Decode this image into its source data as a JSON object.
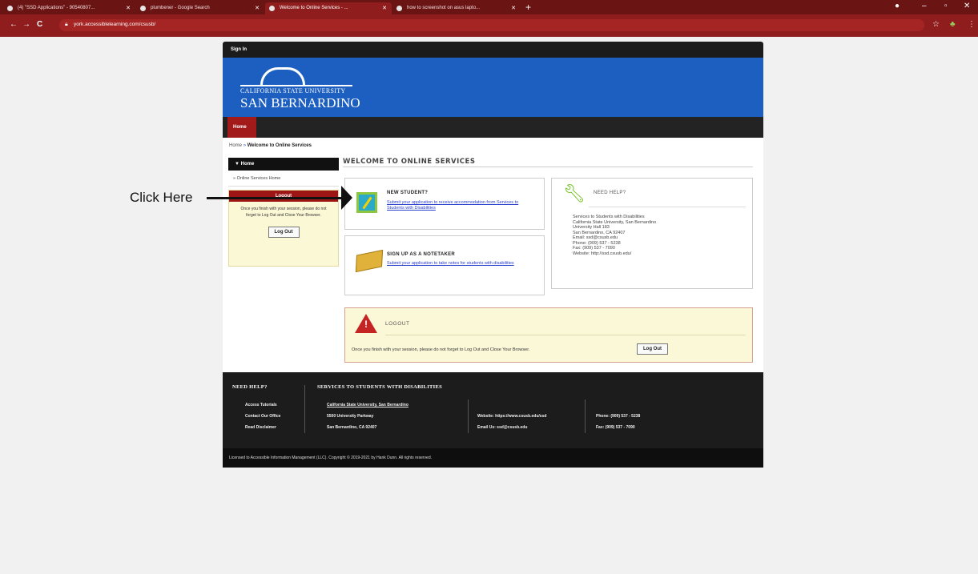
{
  "browser": {
    "tabs": [
      {
        "label": "(4) \"SSD Applications\" - 90540807..."
      },
      {
        "label": "plumbener - Google Search"
      },
      {
        "label": "Welcome to Online Services - ...",
        "active": true
      },
      {
        "label": "how to screenshot on asus lapto..."
      }
    ],
    "new_tab": "+",
    "url": "york.accessiblelearning.com/csusb/",
    "back": "←",
    "forward": "→",
    "reload": "C",
    "min": "–",
    "max": "▫",
    "close": "✕",
    "star": "☆",
    "profile": "●"
  },
  "site": {
    "signin": "Sign In",
    "logo_line1": "CALIFORNIA STATE UNIVERSITY",
    "logo_line2": "SAN BERNARDINO",
    "nav_home": "Home",
    "breadcrumb_home": "Home",
    "breadcrumb_sep": "»",
    "breadcrumb_current": "Welcome to Online Services",
    "leftnav_header": "▼ Home",
    "leftnav_item": "» Online Services Home",
    "logout_header": "Logout",
    "logout_text": "Once you finish with your session, please do not forget to Log Out and Close Your Browser.",
    "logout_button": "Log Out",
    "welcome_title": "WELCOME TO ONLINE SERVICES",
    "new_student_title": "NEW STUDENT?",
    "new_student_link": "Submit your application to receive accommodation from Services to Students with Disabilities",
    "notetaker_title": "SIGN UP AS A NOTETAKER",
    "notetaker_link": "Submit your application to take notes for students with disabilities",
    "help_title": "NEED HELP?",
    "help_contact": [
      "Services to Students with Disabilities",
      "California State University, San Bernardino",
      "University Hall 183",
      "San Bernardino, CA 92407",
      "Email: ssd@csusb.edu",
      "Phone: (909) 537 - 5238",
      "Fax: (909) 537 - 7090",
      "Website: http://ssd.csusb.edu/"
    ],
    "logout_card_title": "LOGOUT",
    "logout_card_text": "Once you finish with your session, please do not forget to Log Out and Close Your Browser.",
    "logout_card_button": "Log Out",
    "footer": {
      "help_head": "NEED HELP?",
      "help_links": [
        "Access Tutorials",
        "Contact Our Office",
        "Read Disclaimer"
      ],
      "services_head": "SERVICES TO STUDENTS WITH DISABILITIES",
      "org": "California State University, San Bernardino",
      "address1": "5500 University Parkway",
      "address2": "San Bernardino, CA 92407",
      "website": "Website: https://www.csusb.edu/ssd",
      "email": "Email Us: ssd@csusb.edu",
      "phone": "Phone: (909) 537 - 5238",
      "fax": "Fax: (909) 537 - 7090"
    },
    "copyright": "Licensed to Accessible Information Management (LLC). Copyright © 2019-2021 by Hank Dunn. All rights reserved."
  },
  "annotation": {
    "label": "Click Here"
  }
}
